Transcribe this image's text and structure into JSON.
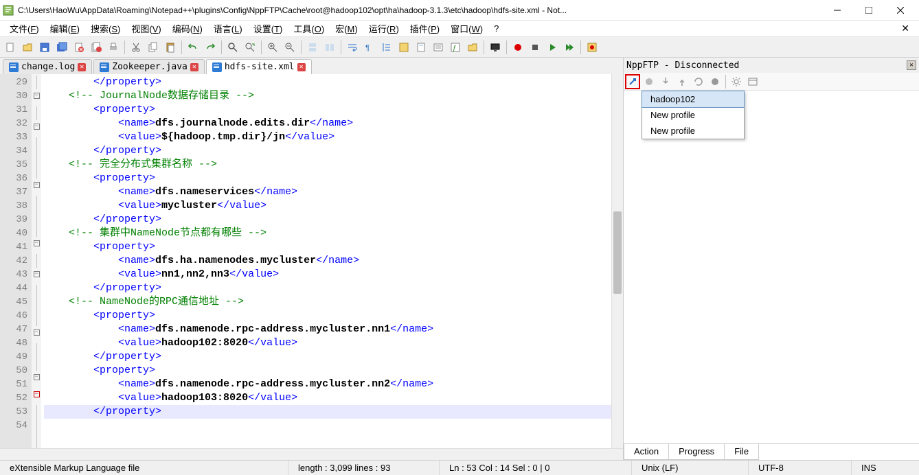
{
  "window": {
    "title": "C:\\Users\\HaoWu\\AppData\\Roaming\\Notepad++\\plugins\\Config\\NppFTP\\Cache\\root@hadoop102\\opt\\ha\\hadoop-3.1.3\\etc\\hadoop\\hdfs-site.xml - Not..."
  },
  "menus": [
    "文件(F)",
    "编辑(E)",
    "搜索(S)",
    "视图(V)",
    "编码(N)",
    "语言(L)",
    "设置(T)",
    "工具(O)",
    "宏(M)",
    "运行(R)",
    "插件(P)",
    "窗口(W)",
    "?"
  ],
  "tabs": [
    {
      "label": "change.log",
      "active": false,
      "modified": true
    },
    {
      "label": "Zookeeper.java",
      "active": false,
      "modified": true
    },
    {
      "label": "hdfs-site.xml",
      "active": true,
      "modified": true
    }
  ],
  "gutter_start": 29,
  "gutter_count": 26,
  "code_lines": [
    {
      "indent": 8,
      "html": "<span class='c-tag'>&lt;/property&gt;</span>"
    },
    {
      "indent": 4,
      "html": "<span class='c-comment'>&lt;!-- JournalNode数据存储目录 --&gt;</span>"
    },
    {
      "indent": 8,
      "html": "<span class='c-tag'>&lt;property&gt;</span>"
    },
    {
      "indent": 12,
      "html": "<span class='c-tag'>&lt;name&gt;</span><span class='c-text'>dfs.journalnode.edits.dir</span><span class='c-tag'>&lt;/name&gt;</span>"
    },
    {
      "indent": 12,
      "html": "<span class='c-tag'>&lt;value&gt;</span><span class='c-text'>${hadoop.tmp.dir}/jn</span><span class='c-tag'>&lt;/value&gt;</span>"
    },
    {
      "indent": 8,
      "html": "<span class='c-tag'>&lt;/property&gt;</span>"
    },
    {
      "indent": 4,
      "html": "<span class='c-comment'>&lt;!-- 完全分布式集群名称 --&gt;</span>"
    },
    {
      "indent": 8,
      "html": "<span class='c-tag'>&lt;property&gt;</span>"
    },
    {
      "indent": 12,
      "html": "<span class='c-tag'>&lt;name&gt;</span><span class='c-text'>dfs.nameservices</span><span class='c-tag'>&lt;/name&gt;</span>"
    },
    {
      "indent": 12,
      "html": "<span class='c-tag'>&lt;value&gt;</span><span class='c-text'>mycluster</span><span class='c-tag'>&lt;/value&gt;</span>"
    },
    {
      "indent": 8,
      "html": "<span class='c-tag'>&lt;/property&gt;</span>"
    },
    {
      "indent": 4,
      "html": "<span class='c-comment'>&lt;!-- 集群中NameNode节点都有哪些 --&gt;</span>"
    },
    {
      "indent": 8,
      "html": "<span class='c-tag'>&lt;property&gt;</span>"
    },
    {
      "indent": 12,
      "html": "<span class='c-tag'>&lt;name&gt;</span><span class='c-text'>dfs.ha.namenodes.mycluster</span><span class='c-tag'>&lt;/name&gt;</span>"
    },
    {
      "indent": 12,
      "html": "<span class='c-tag'>&lt;value&gt;</span><span class='c-text'>nn1,nn2,nn3</span><span class='c-tag'>&lt;/value&gt;</span>"
    },
    {
      "indent": 8,
      "html": "<span class='c-tag'>&lt;/property&gt;</span>"
    },
    {
      "indent": 4,
      "html": "<span class='c-comment'>&lt;!-- NameNode的RPC通信地址 --&gt;</span>"
    },
    {
      "indent": 8,
      "html": "<span class='c-tag'>&lt;property&gt;</span>"
    },
    {
      "indent": 12,
      "html": "<span class='c-tag'>&lt;name&gt;</span><span class='c-text'>dfs.namenode.rpc-address.mycluster.nn1</span><span class='c-tag'>&lt;/name&gt;</span>"
    },
    {
      "indent": 12,
      "html": "<span class='c-tag'>&lt;value&gt;</span><span class='c-text'>hadoop102:8020</span><span class='c-tag'>&lt;/value&gt;</span>"
    },
    {
      "indent": 8,
      "html": "<span class='c-tag'>&lt;/property&gt;</span>"
    },
    {
      "indent": 8,
      "html": "<span class='c-tag'>&lt;property&gt;</span>"
    },
    {
      "indent": 12,
      "html": "<span class='c-tag'>&lt;name&gt;</span><span class='c-text'>dfs.namenode.rpc-address.mycluster.nn2</span><span class='c-tag'>&lt;/name&gt;</span>"
    },
    {
      "indent": 12,
      "html": "<span class='c-tag'>&lt;value&gt;</span><span class='c-text'>hadoop103:8020</span><span class='c-tag'>&lt;/value&gt;</span>"
    },
    {
      "indent": 8,
      "html": "<span class='c-tag'>&lt;/property&gt;</span>",
      "highlight": true
    },
    {
      "indent": 8,
      "html": ""
    }
  ],
  "fold_markers": {
    "2": "minus",
    "4": "minus",
    "8": "minus",
    "12": "minus",
    "14": "minus",
    "18": "minus",
    "21": "minus",
    "22": "red minus"
  },
  "sidepanel": {
    "title": "NppFTP - Disconnected",
    "dropdown": [
      "hadoop102",
      "New profile",
      "New profile"
    ],
    "bottom_tabs": [
      "Action",
      "Progress",
      "File"
    ]
  },
  "status": {
    "filetype": "eXtensible Markup Language file",
    "length": "length : 3,099    lines : 93",
    "pos": "Ln : 53    Col : 14    Sel : 0 | 0",
    "eol": "Unix (LF)",
    "encoding": "UTF-8",
    "mode": "INS"
  },
  "toolbar_icons": [
    "new",
    "open",
    "save",
    "save-all",
    "close",
    "close-all",
    "print",
    "",
    "cut",
    "copy",
    "paste",
    "",
    "undo",
    "redo",
    "",
    "find",
    "replace",
    "",
    "zoom-in",
    "zoom-out",
    "",
    "sync-v",
    "sync-h",
    "",
    "wrap",
    "show-all",
    "indent-guide",
    "lang",
    "doc-map",
    "doc-list",
    "func-list",
    "folder",
    "",
    "monitor",
    "",
    "rec",
    "stop",
    "play",
    "play-multi",
    "",
    "macro"
  ]
}
